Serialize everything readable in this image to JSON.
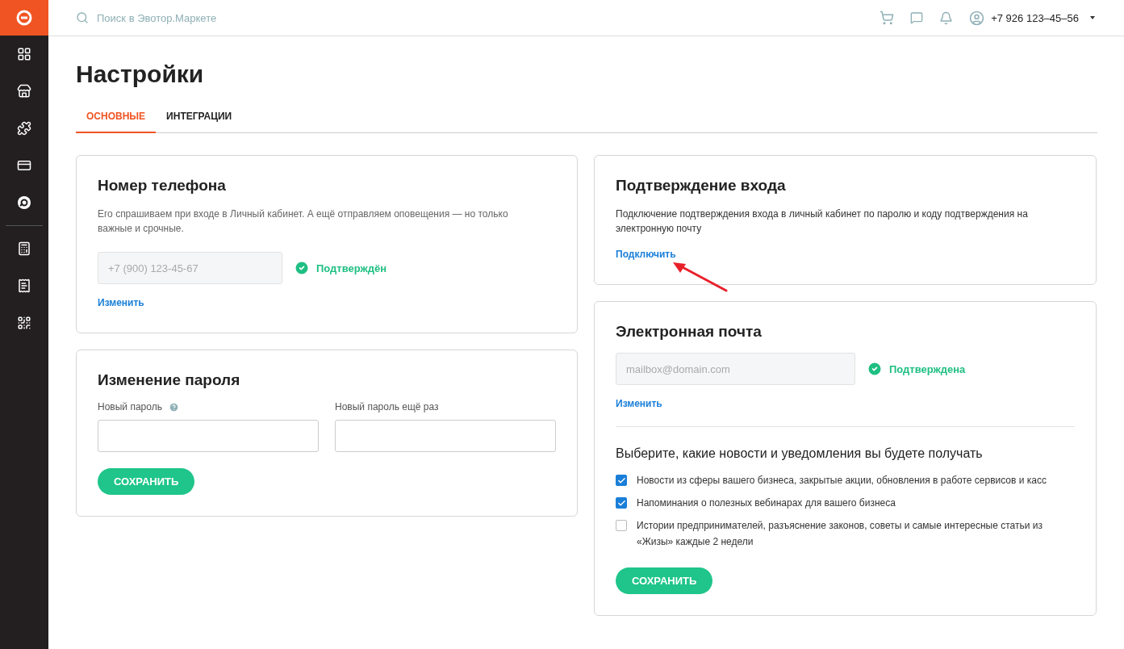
{
  "header": {
    "search": {
      "placeholder": "Поиск в Эвотор.Маркете"
    },
    "user": "+7 926 123–45–56"
  },
  "title": "Настройки",
  "tabs": [
    {
      "label": "ОСНОВНЫЕ",
      "selected": true
    },
    {
      "label": "ИНТЕГРАЦИИ",
      "selected": false
    }
  ],
  "phone_card": {
    "title": "Номер телефона",
    "description": "Его спрашиваем при входе в Личный кабинет. А ещё отправляем оповещения — но только важные и срочные.",
    "field": {
      "placeholder": "+7 (900) 123-45-67"
    },
    "status": "Подтверждён",
    "verified": true,
    "link": "Изменить"
  },
  "password_card": {
    "title": "Изменение пароля",
    "fields": [
      {
        "label": "Новый пароль",
        "help": true
      },
      {
        "label": "Новый пароль ещё раз",
        "help": false
      }
    ],
    "button": "СОХРАНИТЬ"
  },
  "login_confirm_card": {
    "title": "Подтверждение входа",
    "description": "Подключение подтверждения входа в личный кабинет по паролю и коду подтверждения на электронную почту",
    "link": "Подключить"
  },
  "email_card": {
    "title": "Электронная почта",
    "field": {
      "placeholder": "mailbox@domain.com"
    },
    "status": "Подтверждена",
    "verified": true,
    "link": "Изменить",
    "subscriptions_title": "Выберите, какие новости и уведомления вы будете получать",
    "subscriptions": [
      {
        "label": "Новости из сферы вашего бизнеса, закрытые акции, обновления в работе сервисов и касс",
        "checked": true
      },
      {
        "label": "Напоминания о полезных вебинарах для вашего бизнеса",
        "checked": true
      },
      {
        "label": "Истории предпринимателей, разъяснение законов, советы и самые интересные статьи из «Жизы» каждые 2 недели",
        "checked": false
      }
    ],
    "button": "СОХРАНИТЬ"
  }
}
